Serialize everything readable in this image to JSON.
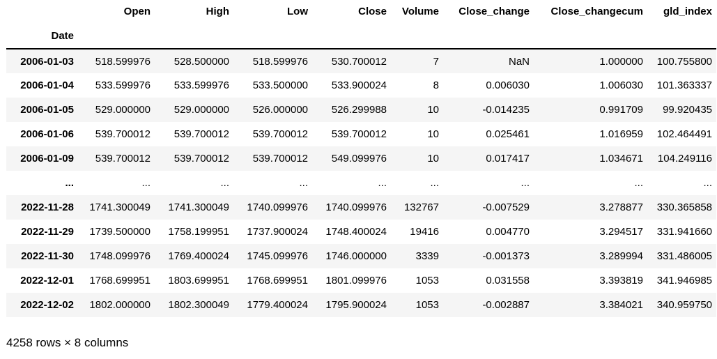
{
  "table": {
    "columns": [
      "Open",
      "High",
      "Low",
      "Close",
      "Volume",
      "Close_change",
      "Close_changecum",
      "gld_index"
    ],
    "index_name": "Date",
    "rows": [
      {
        "index": "2006-01-03",
        "cells": [
          "518.599976",
          "528.500000",
          "518.599976",
          "530.700012",
          "7",
          "NaN",
          "1.000000",
          "100.755800"
        ]
      },
      {
        "index": "2006-01-04",
        "cells": [
          "533.599976",
          "533.599976",
          "533.500000",
          "533.900024",
          "8",
          "0.006030",
          "1.006030",
          "101.363337"
        ]
      },
      {
        "index": "2006-01-05",
        "cells": [
          "529.000000",
          "529.000000",
          "526.000000",
          "526.299988",
          "10",
          "-0.014235",
          "0.991709",
          "99.920435"
        ]
      },
      {
        "index": "2006-01-06",
        "cells": [
          "539.700012",
          "539.700012",
          "539.700012",
          "539.700012",
          "10",
          "0.025461",
          "1.016959",
          "102.464491"
        ]
      },
      {
        "index": "2006-01-09",
        "cells": [
          "539.700012",
          "539.700012",
          "539.700012",
          "549.099976",
          "10",
          "0.017417",
          "1.034671",
          "104.249116"
        ]
      },
      {
        "index": "...",
        "cells": [
          "...",
          "...",
          "...",
          "...",
          "...",
          "...",
          "...",
          "..."
        ]
      },
      {
        "index": "2022-11-28",
        "cells": [
          "1741.300049",
          "1741.300049",
          "1740.099976",
          "1740.099976",
          "132767",
          "-0.007529",
          "3.278877",
          "330.365858"
        ]
      },
      {
        "index": "2022-11-29",
        "cells": [
          "1739.500000",
          "1758.199951",
          "1737.900024",
          "1748.400024",
          "19416",
          "0.004770",
          "3.294517",
          "331.941660"
        ]
      },
      {
        "index": "2022-11-30",
        "cells": [
          "1748.099976",
          "1769.400024",
          "1745.099976",
          "1746.000000",
          "3339",
          "-0.001373",
          "3.289994",
          "331.486005"
        ]
      },
      {
        "index": "2022-12-01",
        "cells": [
          "1768.699951",
          "1803.699951",
          "1768.699951",
          "1801.099976",
          "1053",
          "0.031558",
          "3.393819",
          "341.946985"
        ]
      },
      {
        "index": "2022-12-02",
        "cells": [
          "1802.000000",
          "1802.300049",
          "1779.400024",
          "1795.900024",
          "1053",
          "-0.002887",
          "3.384021",
          "340.959750"
        ]
      }
    ]
  },
  "shape_text": "4258 rows × 8 columns"
}
